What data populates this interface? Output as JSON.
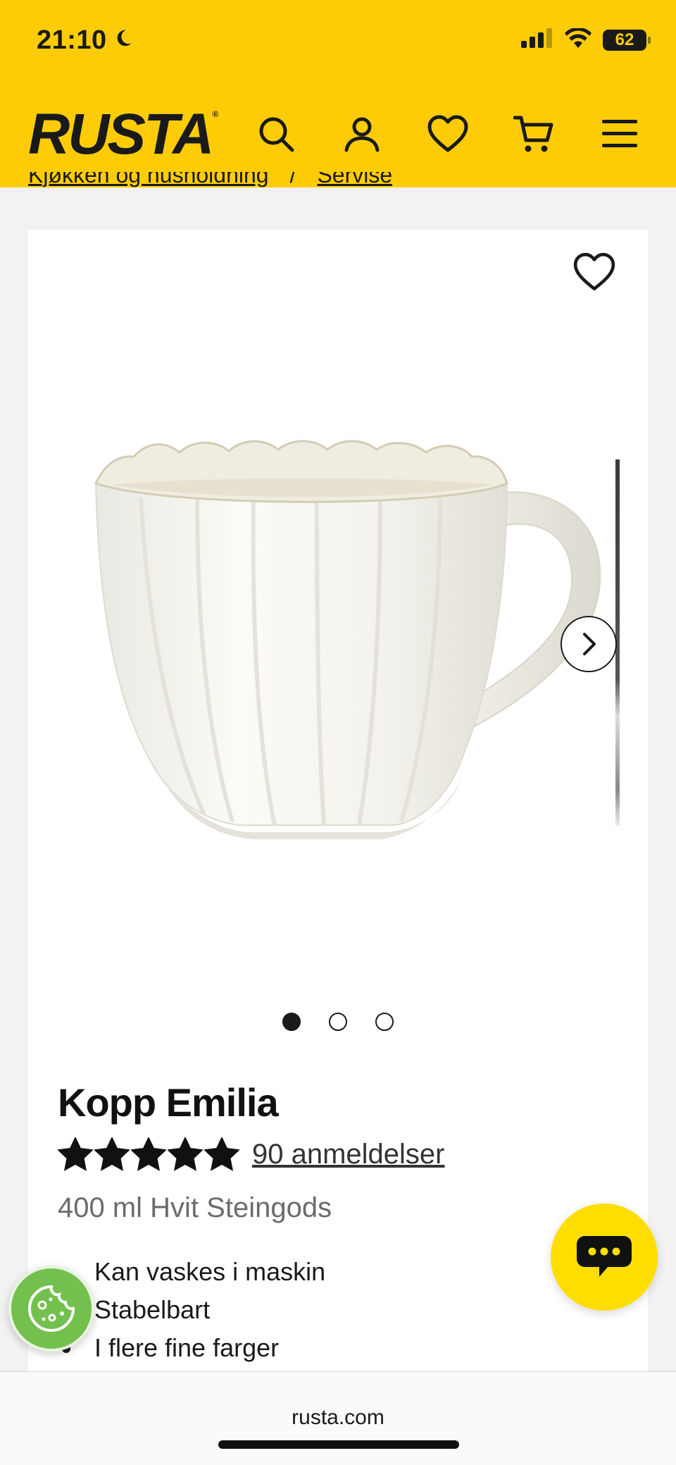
{
  "status_bar": {
    "time": "21:10",
    "battery": "62",
    "icons": [
      "moon-icon",
      "signal-icon",
      "wifi-icon",
      "battery-icon"
    ]
  },
  "header": {
    "logo": "RUSTA",
    "logo_mark": "®",
    "background": "#fdcc07",
    "icons": [
      "search-icon",
      "account-icon",
      "heart-icon",
      "cart-icon",
      "menu-icon"
    ]
  },
  "breadcrumb": {
    "items": [
      "Kjøkken og husholdning",
      "Servise"
    ],
    "separator": "/"
  },
  "product": {
    "title": "Kopp Emilia",
    "rating": 5,
    "rating_max": 5,
    "reviews_label": "90 anmeldelser",
    "subtitle": "400 ml Hvit Steingods",
    "features": [
      "Kan vaskes i maskin",
      "Stabelbart",
      "I flere fine farger"
    ],
    "gallery": {
      "slide_count": 3,
      "active_index": 0
    }
  },
  "browser": {
    "url": "rusta.com"
  },
  "colors": {
    "brand_yellow": "#fdcc07",
    "chat_yellow": "#fdde00",
    "cookie_green": "#74c04e",
    "text": "#1a1a1a"
  }
}
